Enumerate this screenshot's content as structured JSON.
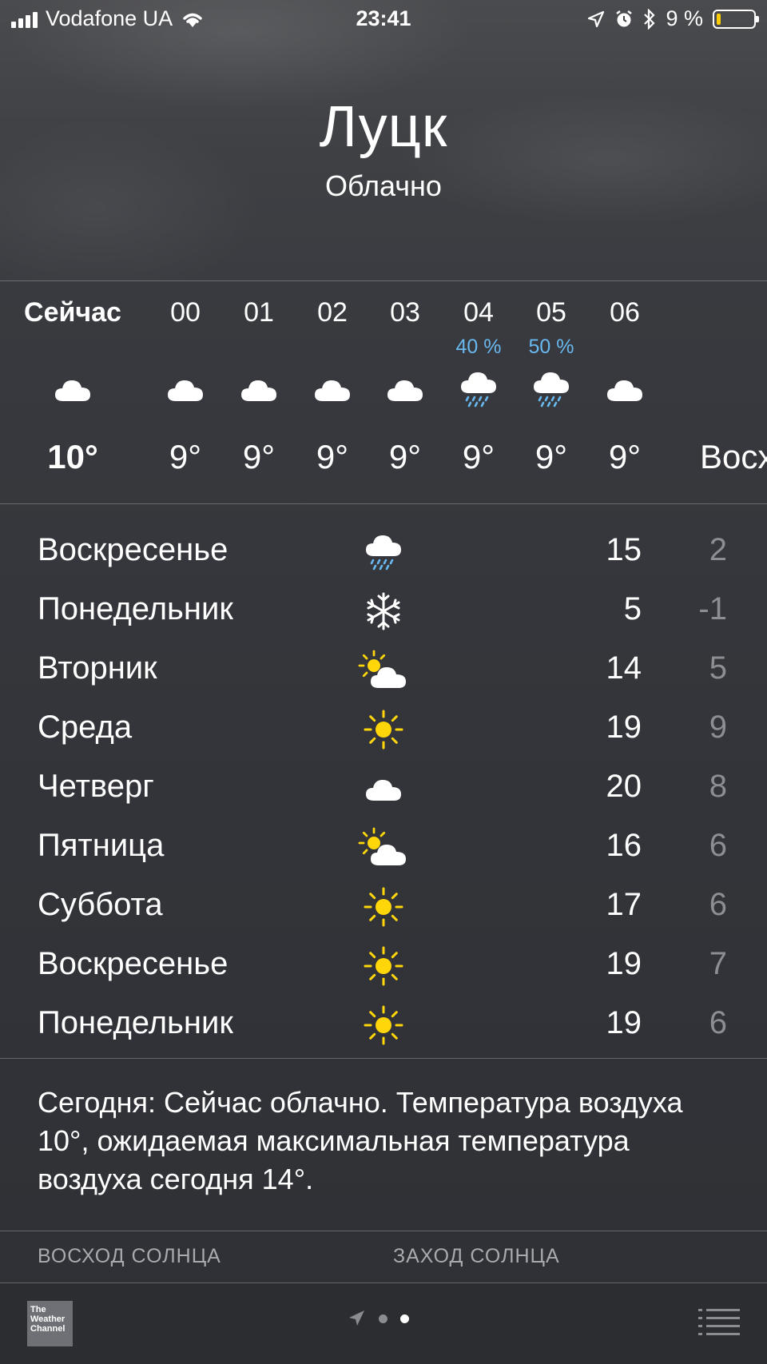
{
  "status_bar": {
    "carrier": "Vodafone UA",
    "time": "23:41",
    "battery": "9 %",
    "battery_level": 0.09
  },
  "location": {
    "city": "Луцк",
    "condition": "Облачно"
  },
  "hourly": [
    {
      "time": "Сейчас",
      "precip": "",
      "icon": "cloud-icon",
      "temp": "10°"
    },
    {
      "time": "00",
      "precip": "",
      "icon": "cloud-icon",
      "temp": "9°"
    },
    {
      "time": "01",
      "precip": "",
      "icon": "cloud-icon",
      "temp": "9°"
    },
    {
      "time": "02",
      "precip": "",
      "icon": "cloud-icon",
      "temp": "9°"
    },
    {
      "time": "03",
      "precip": "",
      "icon": "cloud-icon",
      "temp": "9°"
    },
    {
      "time": "04",
      "precip": "40 %",
      "icon": "rain-cloud-icon",
      "temp": "9°"
    },
    {
      "time": "05",
      "precip": "50 %",
      "icon": "rain-cloud-icon",
      "temp": "9°"
    },
    {
      "time": "06",
      "precip": "",
      "icon": "cloud-icon",
      "temp": "9°"
    },
    {
      "time": "",
      "precip": "",
      "icon": "",
      "temp": "Восх"
    }
  ],
  "daily": [
    {
      "day": "Воскресенье",
      "icon": "rain-cloud-icon",
      "high": "15",
      "low": "2"
    },
    {
      "day": "Понедельник",
      "icon": "snowflake-icon",
      "high": "5",
      "low": "-1"
    },
    {
      "day": "Вторник",
      "icon": "partly-sunny-icon",
      "high": "14",
      "low": "5"
    },
    {
      "day": "Среда",
      "icon": "sun-icon",
      "high": "19",
      "low": "9"
    },
    {
      "day": "Четверг",
      "icon": "cloud-icon",
      "high": "20",
      "low": "8"
    },
    {
      "day": "Пятница",
      "icon": "partly-sunny-icon",
      "high": "16",
      "low": "6"
    },
    {
      "day": "Суббота",
      "icon": "sun-icon",
      "high": "17",
      "low": "6"
    },
    {
      "day": "Воскресенье",
      "icon": "sun-icon",
      "high": "19",
      "low": "7"
    },
    {
      "day": "Понедельник",
      "icon": "sun-icon",
      "high": "19",
      "low": "6"
    }
  ],
  "summary": "Сегодня: Сейчас облачно. Температура воздуха 10°, ожидаемая максимальная температура воздуха сегодня 14°.",
  "details": {
    "sunrise_label": "ВОСХОД СОЛНЦА",
    "sunset_label": "ЗАХОД СОЛНЦА"
  },
  "footer": {
    "logo_text": "The Weather Channel",
    "page_count": 2,
    "current_page": 2
  },
  "colors": {
    "precip": "#69b8f0",
    "sun": "#ffd60a",
    "low_temp": "#8c8e93"
  }
}
